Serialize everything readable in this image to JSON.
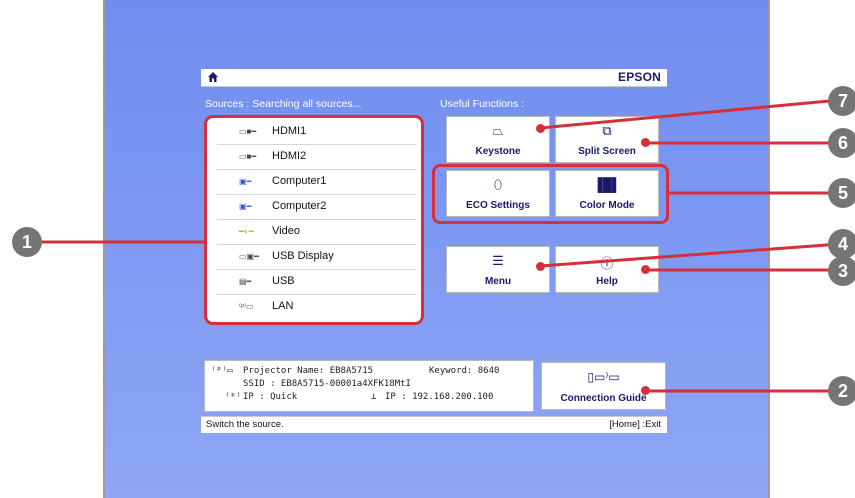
{
  "brand": "EPSON",
  "sources_header": "Sources : Searching all sources...",
  "functions_header": "Useful Functions :",
  "sources": [
    {
      "label": "HDMI1",
      "icon": "hdmi-icon"
    },
    {
      "label": "HDMI2",
      "icon": "hdmi-icon"
    },
    {
      "label": "Computer1",
      "icon": "computer-icon"
    },
    {
      "label": "Computer2",
      "icon": "computer-icon"
    },
    {
      "label": "Video",
      "icon": "video-icon"
    },
    {
      "label": "USB Display",
      "icon": "usb-display-icon"
    },
    {
      "label": "USB",
      "icon": "usb-icon"
    },
    {
      "label": "LAN",
      "icon": "lan-icon"
    }
  ],
  "functions": {
    "keystone": "Keystone",
    "split_screen": "Split Screen",
    "eco_settings": "ECO Settings",
    "color_mode": "Color Mode",
    "menu": "Menu",
    "help": "Help",
    "connection_guide": "Connection Guide"
  },
  "info": {
    "projector_name": "Projector Name: EB8A5715",
    "keyword": "Keyword: 8640",
    "ssid": "SSID : EB8A5715-00001a4XFK18MtI",
    "ip_quick": "IP : Quick",
    "ip": "IP : 192.168.200.100"
  },
  "status": {
    "left": "Switch the source.",
    "right": "[Home] :Exit"
  },
  "callouts": [
    "1",
    "2",
    "3",
    "4",
    "5",
    "6",
    "7"
  ],
  "colors": {
    "accent": "#d4303b",
    "screen": "#7b97f2",
    "text": "#1a1a6a"
  }
}
